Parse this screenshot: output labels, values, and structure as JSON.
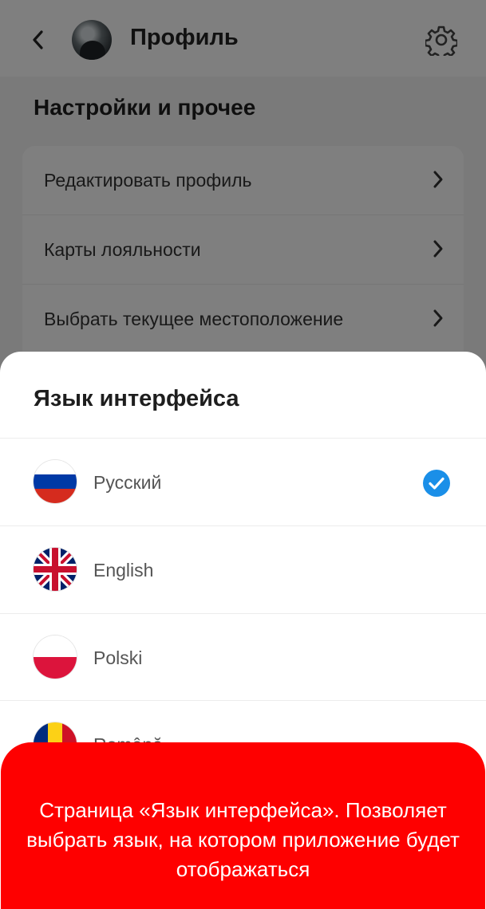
{
  "header": {
    "title": "Профиль",
    "back_icon": "chevron-left-icon",
    "settings_icon": "gear-icon"
  },
  "settings": {
    "section_title": "Настройки и прочее",
    "items": [
      {
        "label": "Редактировать профиль"
      },
      {
        "label": "Карты лояльности"
      },
      {
        "label": "Выбрать текущее местоположение"
      }
    ]
  },
  "language_sheet": {
    "title": "Язык интерфейса",
    "selected": "Русский",
    "options": [
      {
        "label": "Русский",
        "flag": "flag-ru-icon"
      },
      {
        "label": "English",
        "flag": "flag-gb-icon"
      },
      {
        "label": "Polski",
        "flag": "flag-pl-icon"
      },
      {
        "label": "Română",
        "flag": "flag-ro-icon"
      }
    ]
  },
  "annotation": {
    "text": "Страница «Язык интерфейса». Позволяет выбрать язык, на котором приложение будет отображаться"
  },
  "colors": {
    "accent": "#1a8fe8",
    "banner": "#fe0000"
  }
}
